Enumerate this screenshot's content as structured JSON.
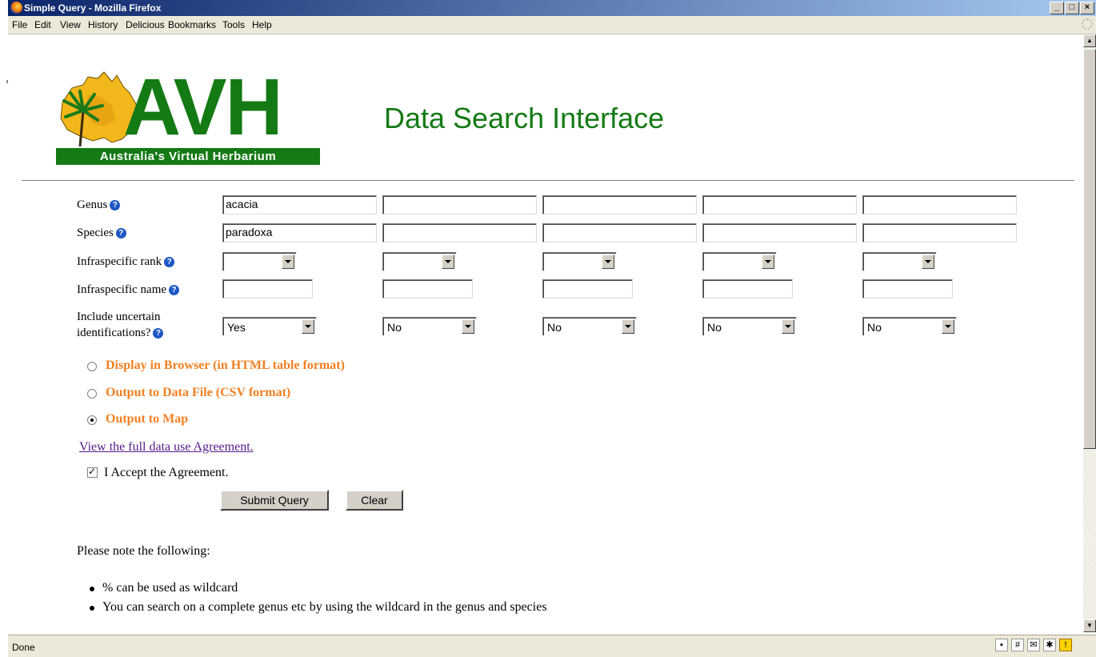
{
  "window": {
    "title": "Simple Query - Mozilla Firefox"
  },
  "menu": [
    "File",
    "Edit",
    "View",
    "History",
    "Delicious",
    "Bookmarks",
    "Tools",
    "Help"
  ],
  "page": {
    "logo_text": "AVH",
    "logo_tagline": "Australia's Virtual Herbarium",
    "heading": "Data Search Interface",
    "rows": {
      "genus": {
        "label": "Genus",
        "values": [
          "acacia",
          "",
          "",
          "",
          ""
        ]
      },
      "species": {
        "label": "Species",
        "values": [
          "paradoxa",
          "",
          "",
          "",
          ""
        ]
      },
      "infra_rank": {
        "label": "Infraspecific rank",
        "values": [
          "",
          "",
          "",
          "",
          ""
        ]
      },
      "infra_name": {
        "label": "Infraspecific name",
        "values": [
          "",
          "",
          "",
          "",
          ""
        ]
      },
      "uncertain": {
        "label_line1": "Include uncertain",
        "label_line2": "identifications?",
        "values": [
          "Yes",
          "No",
          "No",
          "No",
          "No"
        ]
      }
    },
    "output_options": [
      {
        "label": "Display in Browser (in HTML table format)",
        "selected": false
      },
      {
        "label": "Output to Data File (CSV format)",
        "selected": false
      },
      {
        "label": "Output to Map",
        "selected": true
      }
    ],
    "agreement_link": "View the full data use Agreement.",
    "accept_label": "I Accept the Agreement.",
    "accept_checked": true,
    "submit_label": "Submit Query",
    "clear_label": "Clear",
    "note_heading": "Please note the following:",
    "notes": [
      "% can be used as wildcard",
      "You can search on a complete genus etc by using the wildcard in the genus and species"
    ]
  },
  "status": {
    "text": "Done"
  },
  "colors": {
    "avh_green": "#147a14",
    "option_orange": "#f37f20",
    "link_purple": "#551a8b",
    "help_blue": "#1d57c4"
  },
  "help_icon_glyph": "?"
}
